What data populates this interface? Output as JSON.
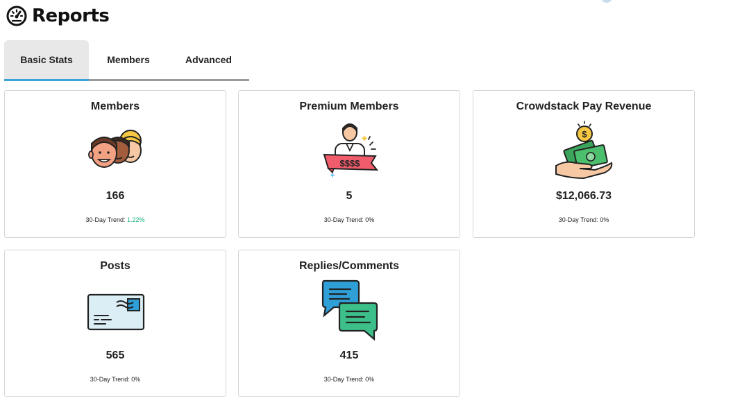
{
  "header": {
    "title": "Reports",
    "icon": "speedometer-icon"
  },
  "tabs": [
    {
      "label": "Basic Stats",
      "active": true
    },
    {
      "label": "Members",
      "active": false
    },
    {
      "label": "Advanced",
      "active": false
    }
  ],
  "cards": [
    {
      "title": "Members",
      "icon": "members-group-icon",
      "value": "166",
      "trend_label": "30-Day Trend:",
      "trend_value": "1.22%"
    },
    {
      "title": "Premium Members",
      "icon": "premium-member-icon",
      "value": "5",
      "trend_label": "30-Day Trend:",
      "trend_value": "0%"
    },
    {
      "title": "Crowdstack Pay Revenue",
      "icon": "money-hand-icon",
      "value": "$12,066.73",
      "trend_label": "30-Day Trend:",
      "trend_value": "0%"
    },
    {
      "title": "Posts",
      "icon": "envelope-card-icon",
      "value": "565",
      "trend_label": "30-Day Trend:",
      "trend_value": "0%"
    },
    {
      "title": "Replies/Comments",
      "icon": "chat-bubbles-icon",
      "value": "415",
      "trend_label": "30-Day Trend:",
      "trend_value": "0%"
    }
  ],
  "premium_badge_text": "$$$$",
  "colors": {
    "tab_active_underline": "#3aa5d9",
    "trend_positive": "#16b07e",
    "card_border": "#d6d6d6"
  }
}
